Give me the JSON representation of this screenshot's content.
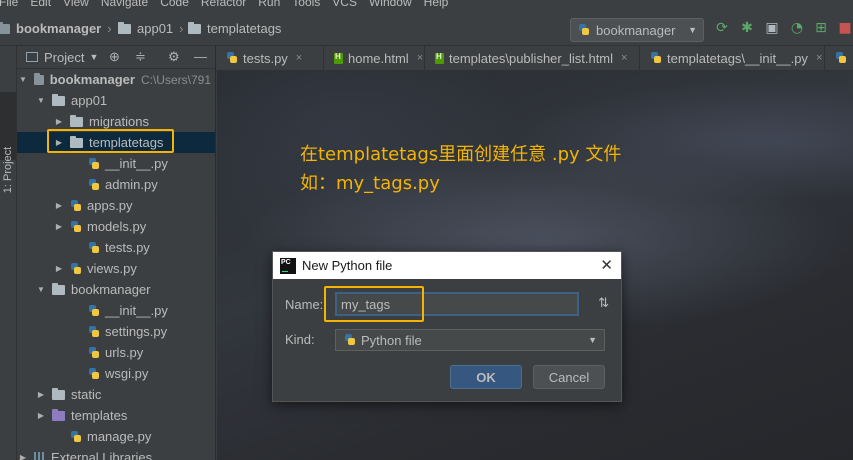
{
  "menu": [
    "File",
    "Edit",
    "View",
    "Navigate",
    "Code",
    "Refactor",
    "Run",
    "Tools",
    "VCS",
    "Window",
    "Help"
  ],
  "breadcrumb": [
    "bookmanager",
    "app01",
    "templatetags"
  ],
  "run_config": "bookmanager",
  "toolbar_icons": [
    "rerun-icon",
    "debug-icon",
    "coverage-icon",
    "profile-icon",
    "run-concurrency-icon",
    "stop-icon"
  ],
  "stripe_label": "1: Project",
  "project_panel": {
    "title": "Project"
  },
  "tree": [
    {
      "label": "bookmanager",
      "hint": "C:\\Users\\791",
      "icon": "folder",
      "arrow": "down",
      "indent": 0,
      "bold": true
    },
    {
      "label": "app01",
      "icon": "folder",
      "arrow": "down",
      "indent": 1
    },
    {
      "label": "migrations",
      "icon": "folder",
      "arrow": "right",
      "indent": 2
    },
    {
      "label": "templatetags",
      "icon": "folder",
      "arrow": "right",
      "indent": 2,
      "selected": true
    },
    {
      "label": "__init__.py",
      "icon": "py",
      "indent": 3
    },
    {
      "label": "admin.py",
      "icon": "py",
      "indent": 3
    },
    {
      "label": "apps.py",
      "icon": "py",
      "arrow": "right",
      "indent": 2
    },
    {
      "label": "models.py",
      "icon": "py",
      "arrow": "right",
      "indent": 2
    },
    {
      "label": "tests.py",
      "icon": "py",
      "indent": 3
    },
    {
      "label": "views.py",
      "icon": "py",
      "arrow": "right",
      "indent": 2
    },
    {
      "label": "bookmanager",
      "icon": "folder",
      "arrow": "down",
      "indent": 1
    },
    {
      "label": "__init__.py",
      "icon": "py",
      "indent": 3
    },
    {
      "label": "settings.py",
      "icon": "py",
      "indent": 3
    },
    {
      "label": "urls.py",
      "icon": "py",
      "indent": 3
    },
    {
      "label": "wsgi.py",
      "icon": "py",
      "indent": 3
    },
    {
      "label": "static",
      "icon": "folder",
      "arrow": "right",
      "indent": 1
    },
    {
      "label": "templates",
      "icon": "folder-purple",
      "arrow": "right",
      "indent": 1
    },
    {
      "label": "manage.py",
      "icon": "py",
      "indent": 2
    },
    {
      "label": "External Libraries",
      "icon": "lib",
      "arrow": "right",
      "indent": 0
    }
  ],
  "tabs": [
    {
      "label": "tests.py",
      "icon": "py"
    },
    {
      "label": "home.html",
      "icon": "html"
    },
    {
      "label": "templates\\publisher_list.html",
      "icon": "html"
    },
    {
      "label": "templatetags\\__init__.py",
      "icon": "py"
    },
    {
      "label": "",
      "icon": "py"
    }
  ],
  "annotation": "在templatetags里面创建任意 .py 文件\n如：my_tags.py",
  "dialog": {
    "title": "New Python file",
    "name_label": "Name:",
    "name_value": "my_tags",
    "kind_label": "Kind:",
    "kind_value": "Python file",
    "ok": "OK",
    "cancel": "Cancel"
  },
  "colors": {
    "highlight": "#f4b400",
    "background": "#3c3f41",
    "editor": "#2b2b2b",
    "ok_button": "#365880"
  }
}
